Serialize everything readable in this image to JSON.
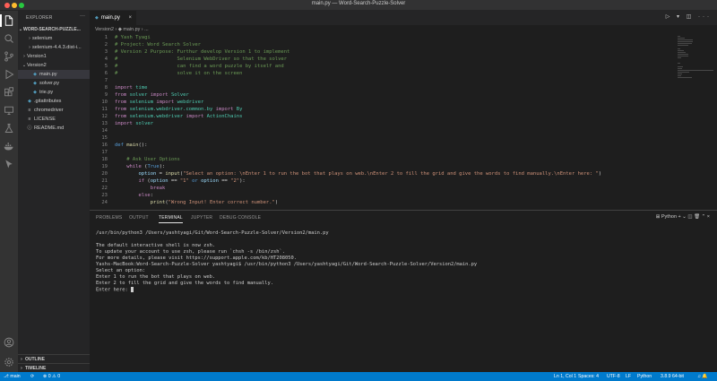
{
  "window": {
    "title": "main.py — Word-Search-Puzzle-Solver",
    "traffic_colors": [
      "#ff5f57",
      "#febc2e",
      "#28c840"
    ]
  },
  "activity_bar": {
    "icons": [
      "files-icon",
      "search-icon",
      "source-control-icon",
      "run-debug-icon",
      "extensions-icon",
      "remote-explorer-icon",
      "testing-icon",
      "docker-icon",
      "kite-icon"
    ],
    "bottom_icons": [
      "account-icon",
      "settings-gear-icon"
    ]
  },
  "sidebar": {
    "title": "EXPLORER",
    "more": "···",
    "project": "WORD-SEARCH-PUZZLE...",
    "items": [
      {
        "label": "selenium",
        "chev": "›",
        "icon": "",
        "depth": 1,
        "color": "#cccccc"
      },
      {
        "label": "selenium-4.4.3.dist-i...",
        "chev": "›",
        "icon": "",
        "depth": 1,
        "color": "#cccccc"
      },
      {
        "label": "Version1",
        "chev": "›",
        "icon": "",
        "depth": 0,
        "color": "#cccccc"
      },
      {
        "label": "Version2",
        "chev": "⌄",
        "icon": "",
        "depth": 0,
        "color": "#cccccc"
      },
      {
        "label": "main.py",
        "chev": "",
        "icon": "◆",
        "depth": 1,
        "color": "#cccccc",
        "selected": true
      },
      {
        "label": "solver.py",
        "chev": "",
        "icon": "◆",
        "depth": 1,
        "color": "#cccccc"
      },
      {
        "label": "trie.py",
        "chev": "",
        "icon": "◆",
        "depth": 1,
        "color": "#cccccc"
      },
      {
        "label": ".gitattributes",
        "chev": "",
        "icon": "◆",
        "depth": 0,
        "color": "#cccccc"
      },
      {
        "label": "chromedriver",
        "chev": "",
        "icon": "≡",
        "depth": 0,
        "color": "#cccccc"
      },
      {
        "label": "LICENSE",
        "chev": "",
        "icon": "≡",
        "depth": 0,
        "color": "#cccccc"
      },
      {
        "label": "README.md",
        "chev": "",
        "icon": "ⓘ",
        "depth": 0,
        "color": "#cccccc"
      }
    ],
    "outline": "OUTLINE",
    "timeline": "TIMELINE"
  },
  "editor": {
    "tab_label": "main.py",
    "tab_close": "×",
    "actions": "▷ ▾ ◫ ···",
    "breadcrumb": "Version2 › ◆ main.py › ...",
    "lines": [
      {
        "n": "1",
        "tokens": [
          [
            "c-com",
            "# Yash Tyagi"
          ]
        ]
      },
      {
        "n": "2",
        "tokens": [
          [
            "c-com",
            "# Project: Word Search Solver"
          ]
        ]
      },
      {
        "n": "3",
        "tokens": [
          [
            "c-com",
            "# Version 2 Purpose: Furthur develop Version 1 to implement"
          ]
        ]
      },
      {
        "n": "4",
        "tokens": [
          [
            "c-com",
            "#                    Selenium WebDriver so that the solver"
          ]
        ]
      },
      {
        "n": "5",
        "tokens": [
          [
            "c-com",
            "#                    can find a word puzzle by itself and"
          ]
        ]
      },
      {
        "n": "6",
        "tokens": [
          [
            "c-com",
            "#                    solve it on the screen"
          ]
        ]
      },
      {
        "n": "7",
        "tokens": []
      },
      {
        "n": "8",
        "tokens": [
          [
            "c-kw",
            "import"
          ],
          [
            "c-txt",
            " "
          ],
          [
            "c-cls",
            "time"
          ]
        ]
      },
      {
        "n": "9",
        "tokens": [
          [
            "c-kw",
            "from"
          ],
          [
            "c-txt",
            " "
          ],
          [
            "c-cls",
            "solver"
          ],
          [
            "c-txt",
            " "
          ],
          [
            "c-kw",
            "import"
          ],
          [
            "c-txt",
            " "
          ],
          [
            "c-cls",
            "Solver"
          ]
        ]
      },
      {
        "n": "10",
        "tokens": [
          [
            "c-kw",
            "from"
          ],
          [
            "c-txt",
            " "
          ],
          [
            "c-cls",
            "selenium"
          ],
          [
            "c-txt",
            " "
          ],
          [
            "c-kw",
            "import"
          ],
          [
            "c-txt",
            " "
          ],
          [
            "c-cls",
            "webdriver"
          ]
        ]
      },
      {
        "n": "11",
        "tokens": [
          [
            "c-kw",
            "from"
          ],
          [
            "c-txt",
            " "
          ],
          [
            "c-cls",
            "selenium.webdriver.common.by"
          ],
          [
            "c-txt",
            " "
          ],
          [
            "c-kw",
            "import"
          ],
          [
            "c-txt",
            " "
          ],
          [
            "c-cls",
            "By"
          ]
        ]
      },
      {
        "n": "12",
        "tokens": [
          [
            "c-kw",
            "from"
          ],
          [
            "c-txt",
            " "
          ],
          [
            "c-cls",
            "selenium.webdriver"
          ],
          [
            "c-txt",
            " "
          ],
          [
            "c-kw",
            "import"
          ],
          [
            "c-txt",
            " "
          ],
          [
            "c-cls",
            "ActionChains"
          ]
        ]
      },
      {
        "n": "13",
        "tokens": [
          [
            "c-kw",
            "import"
          ],
          [
            "c-txt",
            " "
          ],
          [
            "c-cls",
            "solver"
          ]
        ]
      },
      {
        "n": "14",
        "tokens": []
      },
      {
        "n": "15",
        "tokens": []
      },
      {
        "n": "16",
        "tokens": [
          [
            "c-def",
            "def"
          ],
          [
            "c-txt",
            " "
          ],
          [
            "c-fn",
            "main"
          ],
          [
            "c-txt",
            "():"
          ]
        ]
      },
      {
        "n": "17",
        "tokens": []
      },
      {
        "n": "18",
        "tokens": [
          [
            "c-txt",
            "    "
          ],
          [
            "c-com",
            "# Ask User Options"
          ]
        ]
      },
      {
        "n": "19",
        "tokens": [
          [
            "c-txt",
            "    "
          ],
          [
            "c-kw",
            "while"
          ],
          [
            "c-txt",
            " ("
          ],
          [
            "c-def",
            "True"
          ],
          [
            "c-txt",
            "):"
          ]
        ]
      },
      {
        "n": "20",
        "tokens": [
          [
            "c-txt",
            "        "
          ],
          [
            "c-var",
            "option"
          ],
          [
            "c-txt",
            " = "
          ],
          [
            "c-fn",
            "input"
          ],
          [
            "c-txt",
            "("
          ],
          [
            "c-str",
            "\"Select an option: \\nEnter 1 to run the bot that plays on web.\\nEnter 2 to fill the grid and give the words to find manually.\\nEnter here: \""
          ],
          [
            "c-txt",
            ")"
          ]
        ]
      },
      {
        "n": "21",
        "tokens": [
          [
            "c-txt",
            "        "
          ],
          [
            "c-kw",
            "if"
          ],
          [
            "c-txt",
            " ("
          ],
          [
            "c-var",
            "option"
          ],
          [
            "c-txt",
            " == "
          ],
          [
            "c-str",
            "\"1\""
          ],
          [
            "c-txt",
            " "
          ],
          [
            "c-def",
            "or"
          ],
          [
            "c-txt",
            " "
          ],
          [
            "c-var",
            "option"
          ],
          [
            "c-txt",
            " == "
          ],
          [
            "c-str",
            "\"2\""
          ],
          [
            "c-txt",
            "):"
          ]
        ]
      },
      {
        "n": "22",
        "tokens": [
          [
            "c-txt",
            "            "
          ],
          [
            "c-kw",
            "break"
          ]
        ]
      },
      {
        "n": "23",
        "tokens": [
          [
            "c-txt",
            "        "
          ],
          [
            "c-kw",
            "else"
          ],
          [
            "c-txt",
            ":"
          ]
        ]
      },
      {
        "n": "24",
        "tokens": [
          [
            "c-txt",
            "            "
          ],
          [
            "c-fn",
            "print"
          ],
          [
            "c-txt",
            "("
          ],
          [
            "c-str",
            "\"Wrong Input! Enter correct number.\""
          ],
          [
            "c-txt",
            ")"
          ]
        ]
      }
    ]
  },
  "panel": {
    "tabs": [
      "PROBLEMS",
      "OUTPUT",
      "TERMINAL",
      "JUPYTER",
      "DEBUG CONSOLE"
    ],
    "active_tab": "TERMINAL",
    "right_controls": "⊞ Python  +  ⌄  ◫  🗑  ⌃  ×",
    "terminal_lines": [
      "/usr/bin/python3 /Users/yashtyagi/Git/Word-Search-Puzzle-Solver/Version2/main.py",
      "",
      "The default interactive shell is now zsh.",
      "To update your account to use zsh, please run `chsh -s /bin/zsh`.",
      "For more details, please visit https://support.apple.com/kb/HT208050.",
      "Yashs-MacBook:Word-Search-Puzzle-Solver yashtyagi$ /usr/bin/python3 /Users/yashtyagi/Git/Word-Search-Puzzle-Solver/Version2/main.py",
      "Select an option:",
      "Enter 1 to run the bot that plays on web.",
      "Enter 2 to fill the grid and give the words to find manually.",
      "Enter here: "
    ]
  },
  "statusbar": {
    "color": "#007acc",
    "branch": "⎇ main",
    "sync": "⟳",
    "problems": "⊗ 0 ⚠ 0",
    "position": "Ln 1, Col 1",
    "spaces": "Spaces: 4",
    "encoding": "UTF-8",
    "eol": "LF",
    "language": "Python",
    "interpreter": "3.8.9 64-bit",
    "feedback": "♫ 🔔"
  }
}
